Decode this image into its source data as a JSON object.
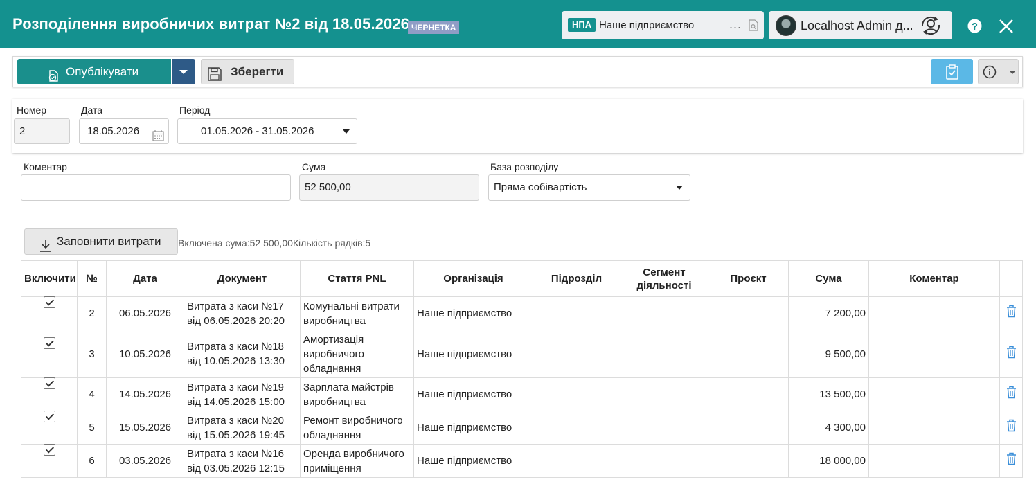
{
  "header": {
    "title": "Розподілення виробничих витрат №2 від 18.05.2026",
    "status_badge": "ЧЕРНЕТКА",
    "org_tag": "НПА",
    "org_name": "Наше підприємство",
    "org_more": "...",
    "user_name": "Localhost Admin д...",
    "help": "?"
  },
  "toolbar": {
    "publish_label": "Опублікувати",
    "save_label": "Зберегти"
  },
  "fields": {
    "number_label": "Номер",
    "number_value": "2",
    "date_label": "Дата",
    "date_value": "18.05.2026",
    "period_label": "Період",
    "period_value": "01.05.2026 - 31.05.2026",
    "comment_label": "Коментар",
    "comment_value": "",
    "sum_label": "Сума",
    "sum_value": "52 500,00",
    "base_label": "База розподілу",
    "base_value": "Пряма собівартість"
  },
  "fill_button_label": "Заповнити витрати",
  "summary_text": "Включена сума:52 500,00Кількість рядків:5",
  "table": {
    "columns": [
      "Включити",
      "№",
      "Дата",
      "Документ",
      "Стаття PNL",
      "Організація",
      "Підрозділ",
      "Сегмент діяльності",
      "Проєкт",
      "Сума",
      "Коментар"
    ],
    "rows": [
      {
        "included": true,
        "no": "2",
        "date": "06.05.2026",
        "doc1": "Витрата з каси №17",
        "doc2": "від 06.05.2026 20:20",
        "pnl": [
          "Комунальні витрати",
          "виробництва"
        ],
        "org": "Наше підприємство",
        "dept": "",
        "segment": "",
        "project": "",
        "sum": "7 200,00",
        "comment": ""
      },
      {
        "included": true,
        "no": "3",
        "date": "10.05.2026",
        "doc1": "Витрата з каси №18",
        "doc2": "від 10.05.2026 13:30",
        "pnl": [
          "Амортизація",
          "виробничого",
          "обладнання"
        ],
        "org": "Наше підприємство",
        "dept": "",
        "segment": "",
        "project": "",
        "sum": "9 500,00",
        "comment": ""
      },
      {
        "included": true,
        "no": "4",
        "date": "14.05.2026",
        "doc1": "Витрата з каси №19",
        "doc2": "від 14.05.2026 15:00",
        "pnl": [
          "Зарплата майстрів",
          "виробництва"
        ],
        "org": "Наше підприємство",
        "dept": "",
        "segment": "",
        "project": "",
        "sum": "13 500,00",
        "comment": ""
      },
      {
        "included": true,
        "no": "5",
        "date": "15.05.2026",
        "doc1": "Витрата з каси №20",
        "doc2": "від 15.05.2026 19:45",
        "pnl": [
          "Ремонт виробничого",
          "обладнання"
        ],
        "org": "Наше підприємство",
        "dept": "",
        "segment": "",
        "project": "",
        "sum": "4 300,00",
        "comment": ""
      },
      {
        "included": true,
        "no": "6",
        "date": "03.05.2026",
        "doc1": "Витрата з каси №16",
        "doc2": "від 03.05.2026 12:15",
        "pnl": [
          "Оренда виробничого",
          "приміщення"
        ],
        "org": "Наше підприємство",
        "dept": "",
        "segment": "",
        "project": "",
        "sum": "18 000,00",
        "comment": ""
      }
    ]
  },
  "colors": {
    "header_bg": "#14918f",
    "publish_bg": "#1a8f8c",
    "caret_bg": "#2e5a87",
    "check_btn_bg": "#5bb8e6",
    "delete_icon": "#3b8fd9"
  },
  "icons": [
    "document-check-icon",
    "caret-down-icon",
    "save-disk-icon",
    "clipboard-check-icon",
    "info-icon",
    "calendar-icon",
    "download-icon",
    "trash-icon",
    "help-icon",
    "close-icon",
    "user-switch-icon",
    "document-search-icon"
  ]
}
